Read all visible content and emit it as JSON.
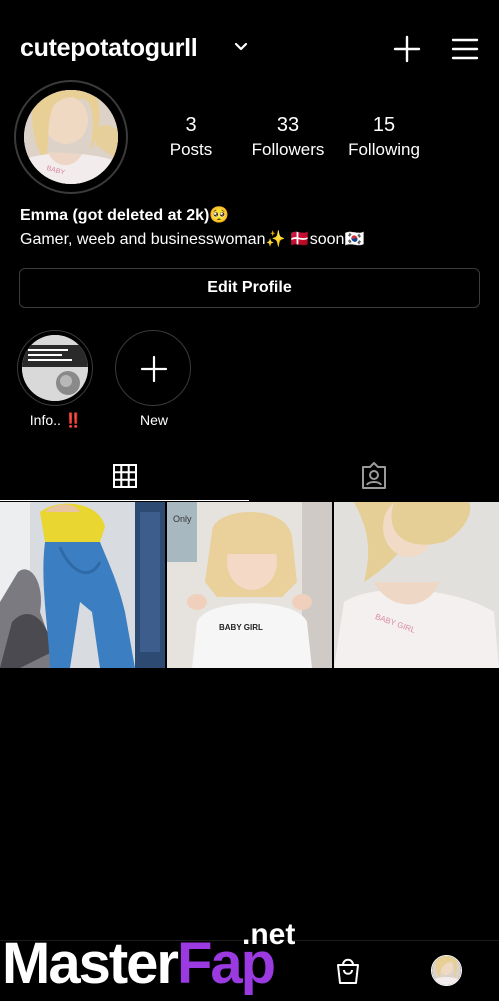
{
  "header": {
    "username": "cutepotatogurll"
  },
  "stats": [
    {
      "value": "3",
      "label": "Posts"
    },
    {
      "value": "33",
      "label": "Followers"
    },
    {
      "value": "15",
      "label": "Following"
    }
  ],
  "bio": {
    "name": "Emma (got deleted at 2k)🥺",
    "text": "Gamer, weeb and businesswoman✨ 🇩🇰soon🇰🇷"
  },
  "edit_profile_label": "Edit Profile",
  "highlights": [
    {
      "label": "Info.. ‼️"
    },
    {
      "label": "New"
    }
  ],
  "watermark": {
    "master": "Master",
    "fap": "Fap",
    "net": ".net"
  },
  "colors": {
    "background": "#000000",
    "text": "#ffffff",
    "border": "#3c3c3c",
    "watermark_accent": "#9a3ae0"
  }
}
